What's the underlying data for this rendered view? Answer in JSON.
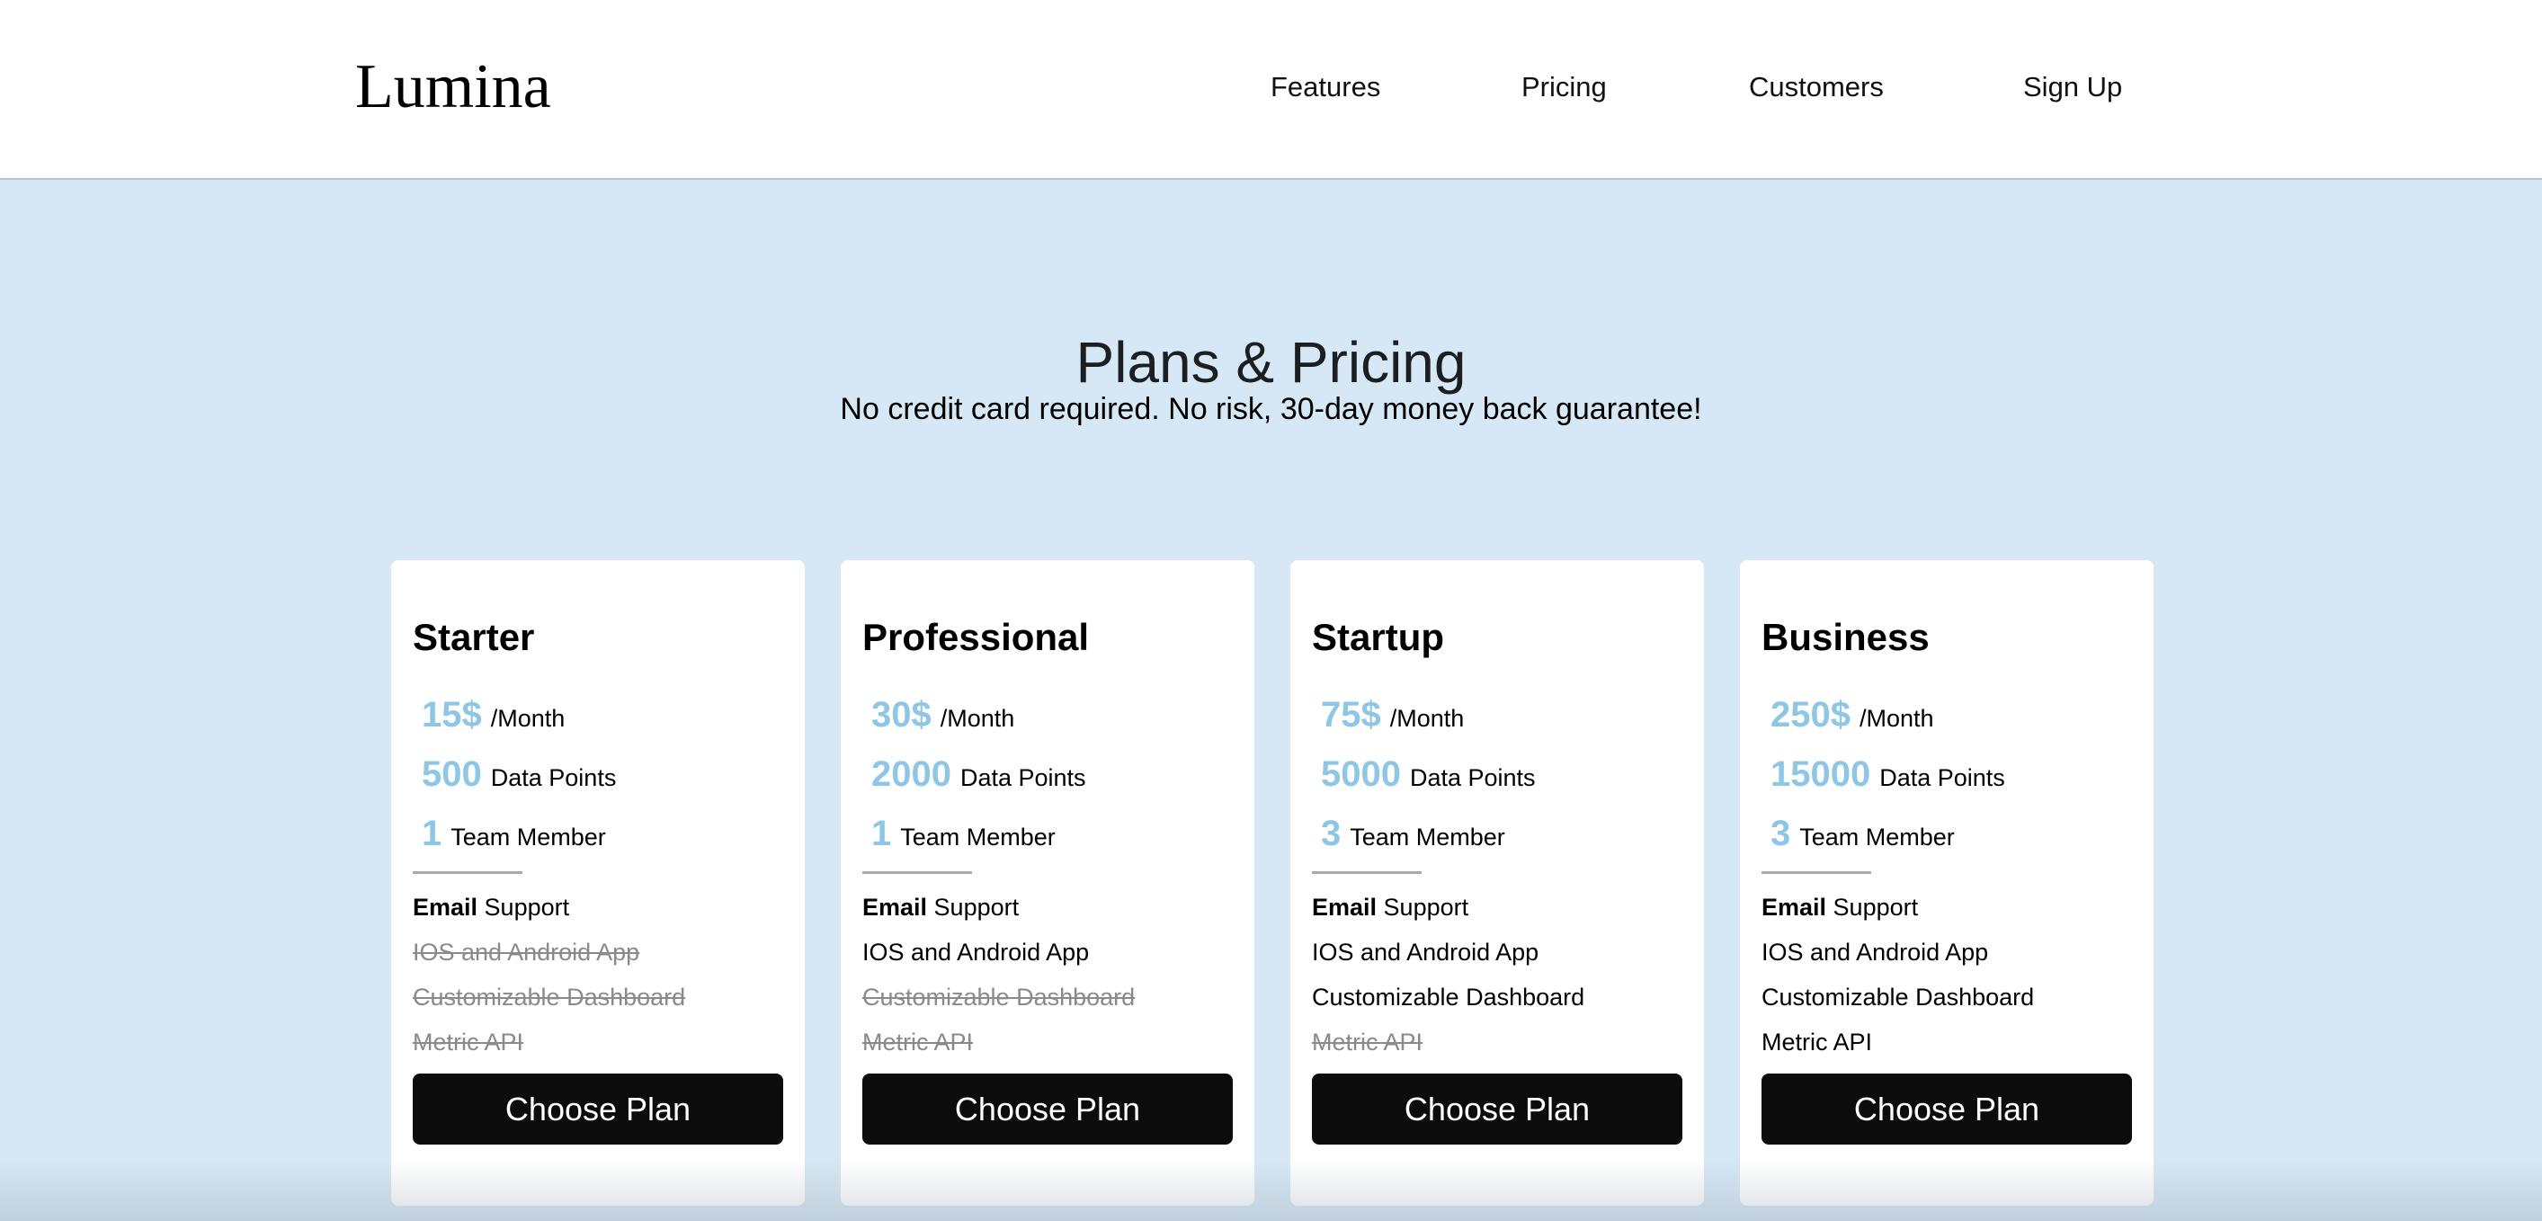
{
  "header": {
    "logo": "Lumina",
    "nav": [
      "Features",
      "Pricing",
      "Customers",
      "Sign Up"
    ]
  },
  "hero": {
    "title": "Plans & Pricing",
    "subtitle": "No credit card required. No risk, 30-day money back guarantee!"
  },
  "plans": [
    {
      "name": "Starter",
      "price": "15$",
      "price_unit": "/Month",
      "data_points": "500",
      "data_points_label": "Data Points",
      "team": "1",
      "team_label": "Team Member",
      "features": [
        {
          "bold": "Email",
          "text": " Support",
          "included": true
        },
        {
          "text": "IOS and Android App",
          "included": false
        },
        {
          "text": "Customizable Dashboard",
          "included": false
        },
        {
          "text": "Metric API",
          "included": false
        }
      ],
      "button": "Choose Plan"
    },
    {
      "name": "Professional",
      "price": "30$",
      "price_unit": "/Month",
      "data_points": "2000",
      "data_points_label": "Data Points",
      "team": "1",
      "team_label": "Team Member",
      "features": [
        {
          "bold": "Email",
          "text": " Support",
          "included": true
        },
        {
          "text": "IOS and Android App",
          "included": true
        },
        {
          "text": "Customizable Dashboard",
          "included": false
        },
        {
          "text": "Metric API",
          "included": false
        }
      ],
      "button": "Choose Plan"
    },
    {
      "name": "Startup",
      "price": "75$",
      "price_unit": "/Month",
      "data_points": "5000",
      "data_points_label": "Data Points",
      "team": "3",
      "team_label": "Team Member",
      "features": [
        {
          "bold": "Email",
          "text": " Support",
          "included": true
        },
        {
          "text": "IOS and Android App",
          "included": true
        },
        {
          "text": "Customizable Dashboard",
          "included": true
        },
        {
          "text": "Metric API",
          "included": false
        }
      ],
      "button": "Choose Plan"
    },
    {
      "name": "Business",
      "price": "250$",
      "price_unit": "/Month",
      "data_points": "15000",
      "data_points_label": "Data Points",
      "team": "3",
      "team_label": "Team Member",
      "features": [
        {
          "bold": "Email",
          "text": " Support",
          "included": true
        },
        {
          "text": "IOS and Android App",
          "included": true
        },
        {
          "text": "Customizable Dashboard",
          "included": true
        },
        {
          "text": "Metric API",
          "included": true
        }
      ],
      "button": "Choose Plan"
    }
  ],
  "colors": {
    "page_bg": "#d6e8f5",
    "accent_number": "#8ec7e6",
    "button_bg": "#0c0c0c",
    "disabled_text": "#8a8a8a"
  }
}
